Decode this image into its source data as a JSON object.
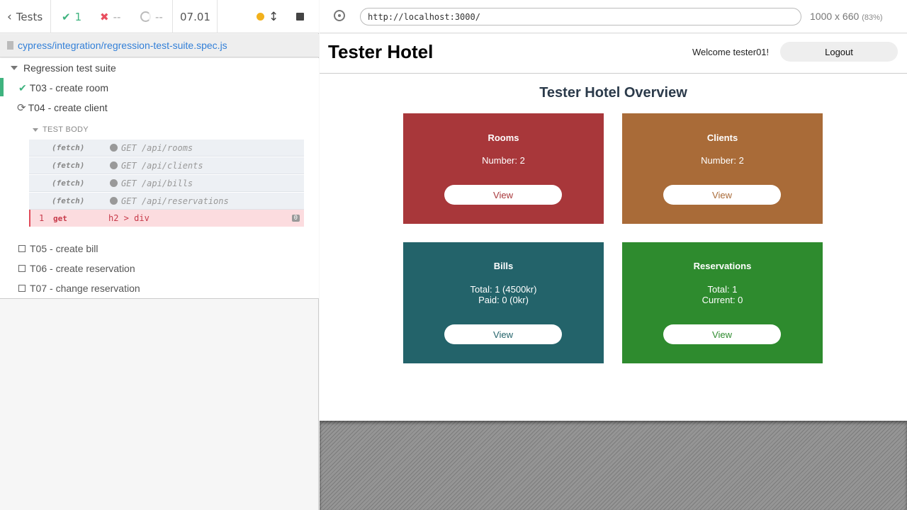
{
  "runner": {
    "tests_label": "Tests",
    "passed": "1",
    "failed": "--",
    "pending": "--",
    "duration": "07.01",
    "spec_path": "cypress/integration/regression-test-suite.spec.js",
    "suite": "Regression test suite",
    "tests": {
      "t03": "T03 - create room",
      "t04": "T04 - create client",
      "t05": "T05 - create bill",
      "t06": "T06 - create reservation",
      "t07": "T07 - change reservation"
    },
    "test_body_label": "TEST BODY",
    "commands": [
      {
        "name": "(fetch)",
        "message": "GET /api/rooms"
      },
      {
        "name": "(fetch)",
        "message": "GET /api/clients"
      },
      {
        "name": "(fetch)",
        "message": "GET /api/bills"
      },
      {
        "name": "(fetch)",
        "message": "GET /api/reservations"
      }
    ],
    "failing_command": {
      "number": "1",
      "name": "get",
      "selector": "h2 > div",
      "badge": "0"
    },
    "colors": {
      "pass": "#3fb37f",
      "fail": "#e94f5f",
      "pending_dot": "#f2b11c",
      "link": "#3380d8"
    }
  },
  "aut": {
    "url": "http://localhost:3000/",
    "viewport": "1000 x 660",
    "scale": "(83%)",
    "site_title": "Tester Hotel",
    "welcome": "Welcome tester01!",
    "logout": "Logout",
    "overview_title": "Tester Hotel Overview",
    "cards": {
      "rooms": {
        "title": "Rooms",
        "line1": "Number: 2",
        "button": "View",
        "color": "#a8373a"
      },
      "clients": {
        "title": "Clients",
        "line1": "Number: 2",
        "button": "View",
        "color": "#a96b38"
      },
      "bills": {
        "title": "Bills",
        "line1": "Total: 1 (4500kr)",
        "line2": "Paid: 0 (0kr)",
        "button": "View",
        "color": "#23636a"
      },
      "reservations": {
        "title": "Reservations",
        "line1": "Total: 1",
        "line2": "Current: 0",
        "button": "View",
        "color": "#2e8b2e"
      }
    }
  }
}
